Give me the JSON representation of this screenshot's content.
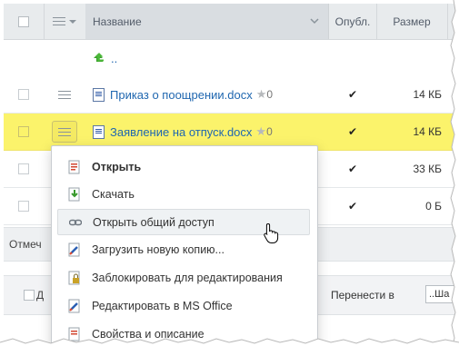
{
  "header": {
    "name_label": "Название",
    "published_label": "Опубл.",
    "size_label": "Размер"
  },
  "up_row": {
    "label": ".."
  },
  "rows": [
    {
      "name": "Приказ о поощрении.docx",
      "rating": "0",
      "published": "✔",
      "size": "14 КБ"
    },
    {
      "name": "Заявление на отпуск.docx",
      "rating": "0",
      "published": "✔",
      "size": "14 КБ"
    },
    {
      "published": "✔",
      "size": "33 КБ"
    },
    {
      "published": "✔",
      "size": "0 Б"
    }
  ],
  "footbar": {
    "label": "Отмеч"
  },
  "actionbar": {
    "label": "Д",
    "move_label": "Перенести в",
    "move_value": "..Ша"
  },
  "context_menu": {
    "items": [
      {
        "label": "Открыть",
        "icon": "open-icon"
      },
      {
        "label": "Скачать",
        "icon": "download-icon"
      },
      {
        "label": "Открыть общий доступ",
        "icon": "link-icon"
      },
      {
        "label": "Загрузить новую копию...",
        "icon": "upload-copy-icon"
      },
      {
        "label": "Заблокировать для редактирования",
        "icon": "lock-icon"
      },
      {
        "label": "Редактировать в MS Office",
        "icon": "edit-office-icon"
      },
      {
        "label": "Свойства и описание",
        "icon": "properties-icon"
      }
    ]
  },
  "colors": {
    "selected_row": "#fbf36b",
    "link": "#2067b0",
    "header_bg": "#e8ebed"
  }
}
